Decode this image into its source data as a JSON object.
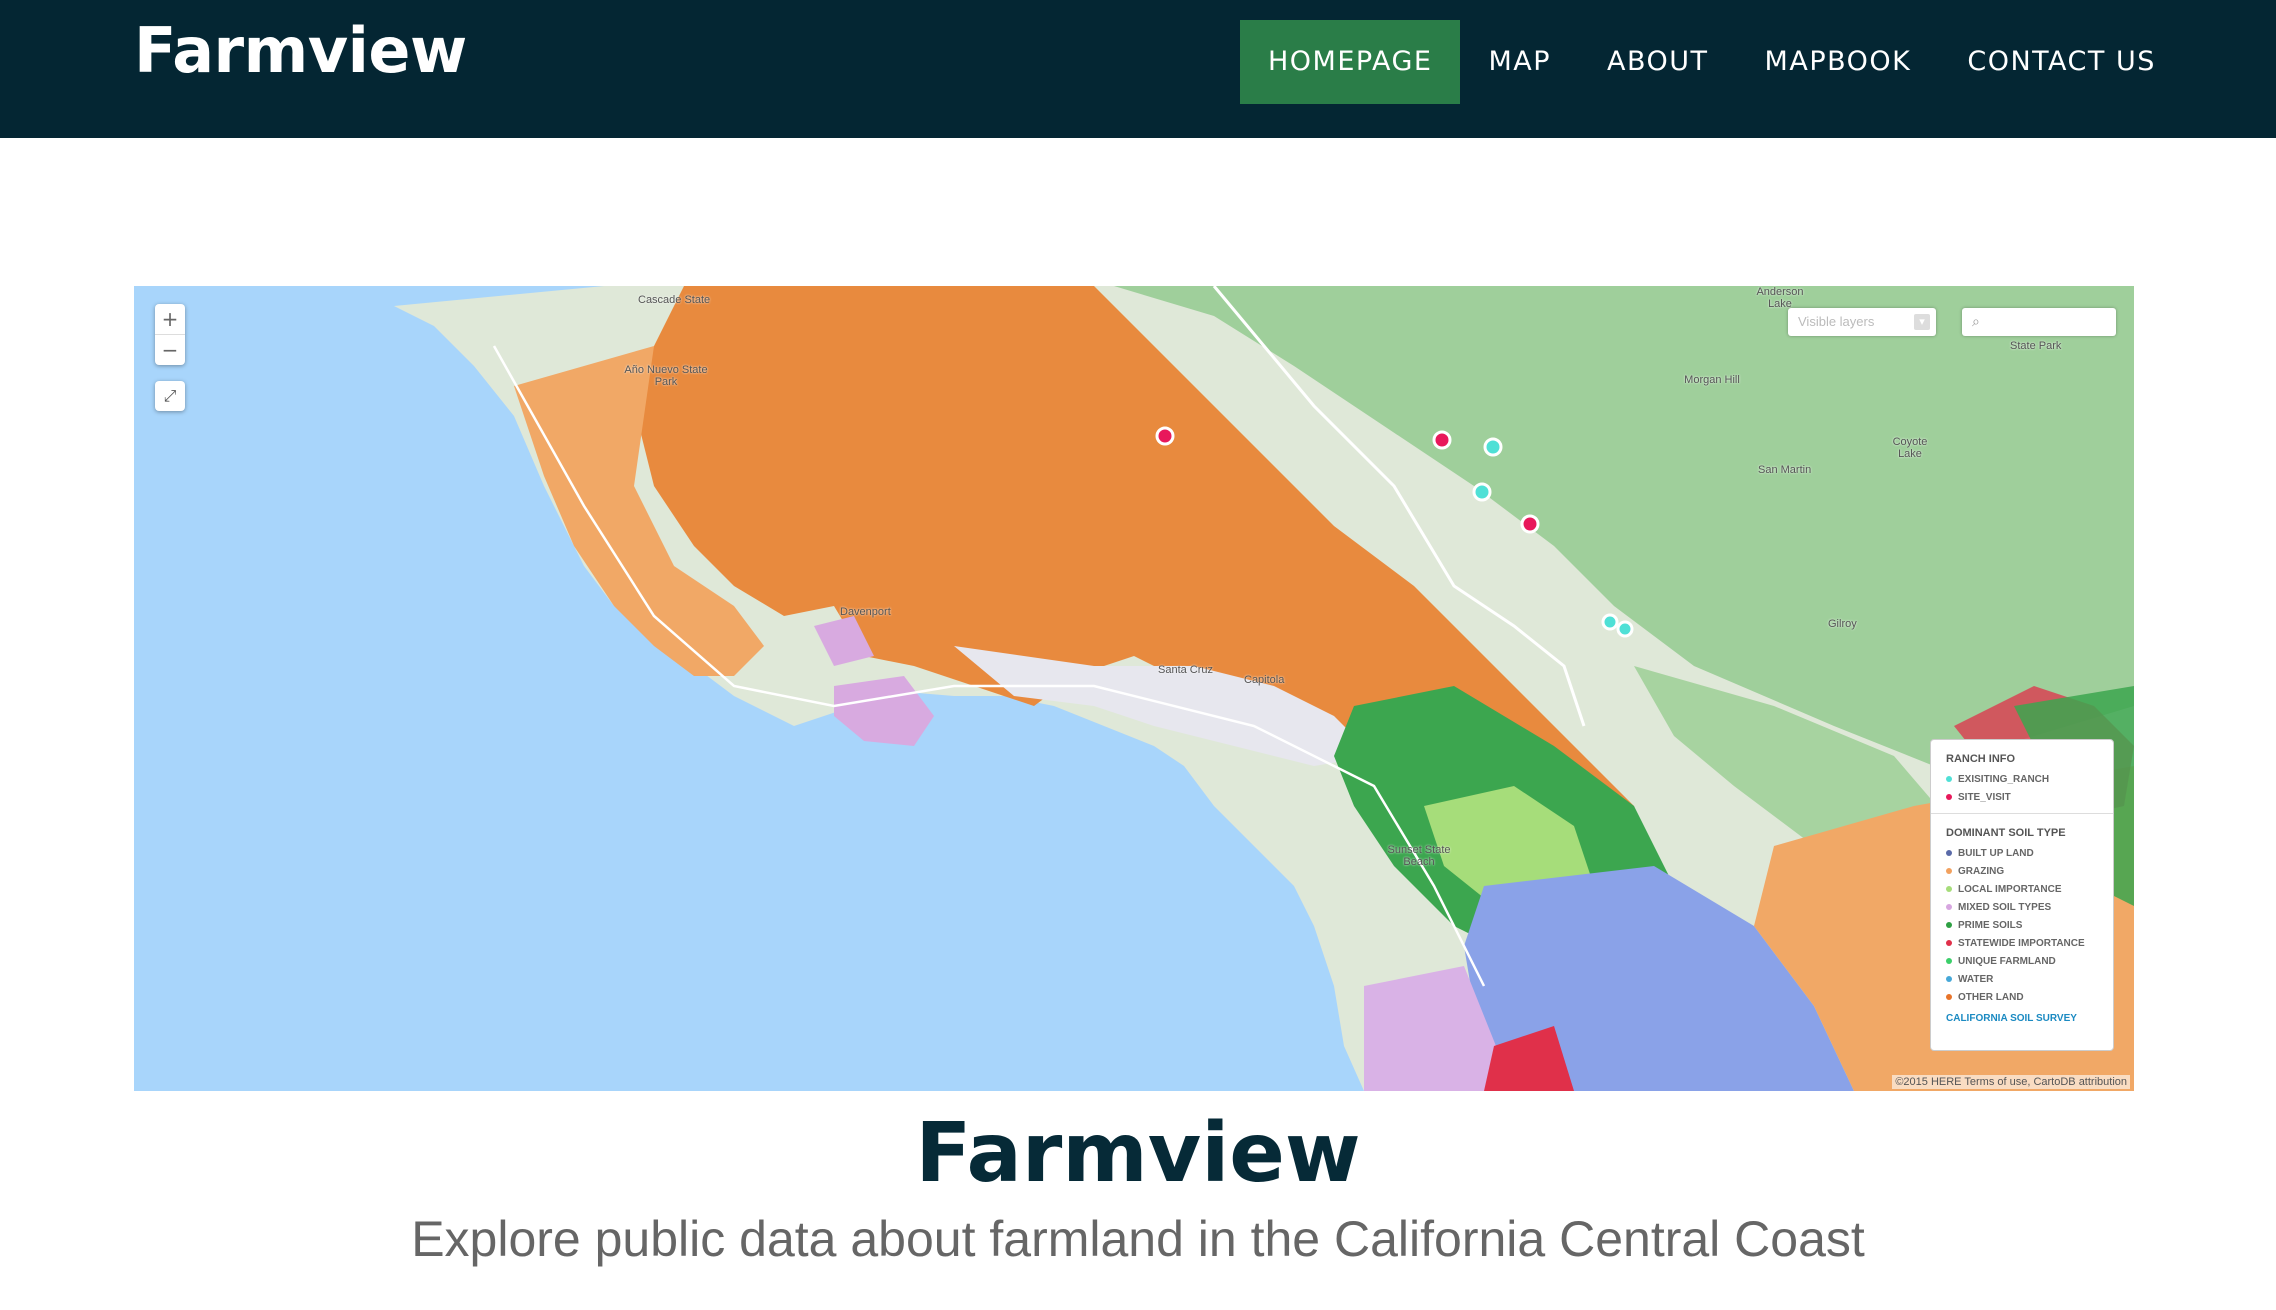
{
  "header": {
    "brand": "Farmview",
    "nav": [
      {
        "label": "HOMEPAGE",
        "active": true
      },
      {
        "label": "MAP",
        "active": false
      },
      {
        "label": "ABOUT",
        "active": false
      },
      {
        "label": "MAPBOOK",
        "active": false
      },
      {
        "label": "CONTACT US",
        "active": false
      }
    ]
  },
  "map": {
    "zoom_in": "+",
    "zoom_out": "−",
    "layers_placeholder": "Visible layers",
    "search_icon": "search-icon",
    "place_labels": [
      "Cascade State",
      "Año Nuevo State Park",
      "Davenport",
      "Santa Cruz",
      "Capitola",
      "Morgan Hill",
      "San Martin",
      "Gilroy",
      "Anderson Lake",
      "Coyote Lake",
      "State Park",
      "Sunset State Beach"
    ],
    "legend": {
      "ranch_title": "RANCH INFO",
      "ranch_items": [
        {
          "label": "EXISITING_RANCH",
          "color": "#4fe0d6"
        },
        {
          "label": "SITE_VISIT",
          "color": "#e8185b"
        }
      ],
      "soil_title": "DOMINANT SOIL TYPE",
      "soil_items": [
        {
          "label": "BUILT UP LAND",
          "color": "#5a6aa8"
        },
        {
          "label": "GRAZING",
          "color": "#f2a15f"
        },
        {
          "label": "LOCAL IMPORTANCE",
          "color": "#a6dd7a"
        },
        {
          "label": "MIXED SOIL TYPES",
          "color": "#d7a6e0"
        },
        {
          "label": "PRIME SOILS",
          "color": "#2ea043"
        },
        {
          "label": "STATEWIDE IMPORTANCE",
          "color": "#e0304a"
        },
        {
          "label": "UNIQUE FARMLAND",
          "color": "#3ccf6a"
        },
        {
          "label": "WATER",
          "color": "#46a8d8"
        },
        {
          "label": "OTHER LAND",
          "color": "#e8742a"
        }
      ],
      "link": "CALIFORNIA SOIL SURVEY"
    },
    "attribution": "©2015 HERE Terms of use, CartoDB attribution"
  },
  "hero": {
    "title": "Farmview",
    "subtitle": "Explore public data about farmland in the California Central Coast"
  }
}
